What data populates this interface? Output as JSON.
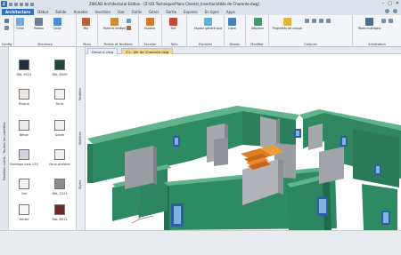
{
  "titlebar": {
    "title": "ZWCAD Architectural Edition - [Z:\\03 Technique\\Plans Clients\\_Insertion\\Allée de Charente.dwg]"
  },
  "ribbon_tabs": [
    {
      "label": "Architecture",
      "active": true
    },
    {
      "label": "Début"
    },
    {
      "label": "Solide"
    },
    {
      "label": "Annoter"
    },
    {
      "label": "Insertion"
    },
    {
      "label": "Vue"
    },
    {
      "label": "Outils"
    },
    {
      "label": "Gérer"
    },
    {
      "label": "Sortie"
    },
    {
      "label": "Express"
    },
    {
      "label": "En ligne"
    },
    {
      "label": "Apps"
    }
  ],
  "ribbon_groups": {
    "config": "Config",
    "structure": "Structure",
    "murs": "Murs",
    "portes": "Portes et fenêtres",
    "escaliers": "Escalier",
    "toits": "Toits",
    "espaces": "Espaces",
    "dessin": "Dessin",
    "modifier": "Modifier",
    "calques": "Calques",
    "annotation": "Annotation"
  },
  "ribbon_buttons": {
    "grille": "Grille",
    "poteau": "Poteau",
    "dalle": "Dalle",
    "mur": "Mur",
    "porte": "Porte et fenêtre",
    "escalier": "Escalier",
    "toit": "Toit",
    "espace": "Espace généré tout",
    "ligne": "Ligne",
    "deplacer": "Déplacer",
    "proprietes": "Propriétés de calque",
    "texte": "Texte multiligne"
  },
  "doc_tabs": [
    {
      "label": "Dessin1.dwg",
      "active": false
    },
    {
      "label": "Z:\\...lée de Charente.dwg",
      "active": true
    }
  ],
  "palette": {
    "side_labels": [
      "Modèles",
      "Matières",
      "Styles"
    ],
    "dock_label": "Palettes outils - Toutes les palettes",
    "swatches": [
      {
        "label": "RAL 9011",
        "color": "#1f2e3d"
      },
      {
        "label": "RAL 6009",
        "color": "#1e4a3a"
      },
      {
        "label": "Brique",
        "color": "#ece7e2"
      },
      {
        "label": "Terre",
        "color": "#f4f1ee"
      },
      {
        "label": "Béton",
        "color": "#ece9e6"
      },
      {
        "label": "Sable",
        "color": "#f2efec"
      },
      {
        "label": "Bardage bois 120",
        "color": "#cfd6de"
      },
      {
        "label": "Faux-plafond",
        "color": "#eef0f3"
      },
      {
        "label": "Ciel",
        "color": "#eef1f5"
      },
      {
        "label": "RAL 7023",
        "color": "#8a8f86"
      },
      {
        "label": "Herbe",
        "color": "#f6f6f6"
      },
      {
        "label": "RAL 8012",
        "color": "#6a2a22"
      }
    ]
  },
  "colors": {
    "accent": "#2f72c2",
    "wall_green": "#2e8a63",
    "wall_top": "#5fb38d",
    "gray_panel": "#a6aaae",
    "stair_orange": "#e07b1f"
  }
}
